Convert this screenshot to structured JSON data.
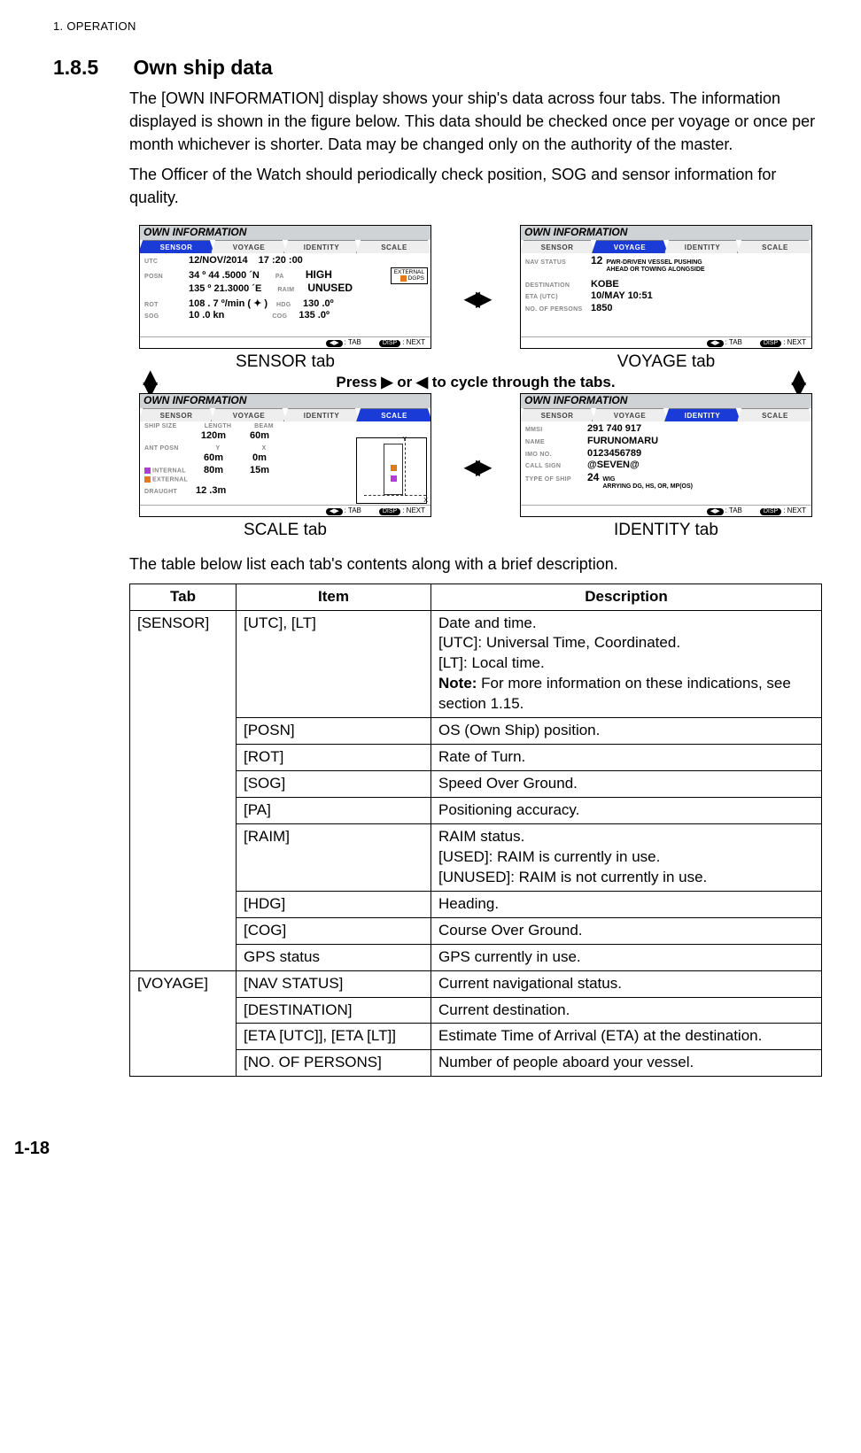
{
  "header": "1.  OPERATION",
  "section_num": "1.8.5",
  "section_title": "Own ship data",
  "para1": "The [OWN INFORMATION] display shows your ship's data across four tabs. The information displayed is shown in the figure below. This data should be checked once per voyage or once per month whichever is shorter. Data may be changed only on the authority of the master.",
  "para2": "The Officer of the Watch should periodically check position, SOG and sensor information for quality.",
  "panel_title": "OWN INFORMATION",
  "tabs": {
    "t1": "SENSOR",
    "t2": "VOYAGE",
    "t3": "IDENTITY",
    "t4": "SCALE"
  },
  "foot": {
    "tab": ": TAB",
    "next": ": NEXT",
    "icon1": "◀▶",
    "icon2": "DISP"
  },
  "cycle": {
    "lr": "◀▶",
    "ud": "◀▶"
  },
  "instruction": "Press ▶ or ◀ to cycle through the tabs.",
  "sensor": {
    "utc_l": "UTC",
    "utc_v": "12/NOV/2014",
    "utc_t": "17 :20 :00",
    "ext1": "EXTERNAL",
    "ext2": "DGPS",
    "posn_l": "POSN",
    "posn_v1": "34 º 44 .5000 ´N",
    "posn_v2": "135 º 21.3000 ´E",
    "pa_l": "PA",
    "pa_v": "HIGH",
    "raim_l": "RAIM",
    "raim_v": "UNUSED",
    "rot_l": "ROT",
    "rot_v": "108 . 7 º/min ( ✦ )",
    "sog_l": "SOG",
    "sog_v": "10 .0 kn",
    "hdg_l": "HDG",
    "hdg_v": "130 .0º",
    "cog_l": "COG",
    "cog_v": "135 .0º"
  },
  "voyage": {
    "nav_l": "NAV STATUS",
    "nav_n": "12",
    "nav_v1": "PWR-DRIVEN VESSEL PUSHING",
    "nav_v2": "AHEAD OR TOWING ALONGSIDE",
    "dest_l": "DESTINATION",
    "dest_v": "KOBE",
    "eta_l": "ETA (UTC)",
    "eta_v": "10/MAY 10:51",
    "nop_l": "NO. OF PERSONS",
    "nop_v": "1850"
  },
  "scale": {
    "ss_l": "SHIP SIZE",
    "len_l": "LENGTH",
    "len_v": "120m",
    "beam_l": "BEAM",
    "beam_v": "60m",
    "ant_l": "ANT  POSN",
    "y_l": "Y",
    "y_v": "60m",
    "x_l": "X",
    "x_v": "0m",
    "int_l": "INTERNAL",
    "int_v": "80m",
    "int_x": "15m",
    "ext_l": "EXTERNAL",
    "dr_l": "DRAUGHT",
    "dr_v": "12 .3m",
    "axis_y": "Y",
    "axis_x": "X"
  },
  "identity": {
    "mmsi_l": "MMSI",
    "mmsi_v": "291 740 917",
    "name_l": "NAME",
    "name_v": "FURUNOMARU",
    "imo_l": "IMO NO.",
    "imo_v": "0123456789",
    "cs_l": "CALL SIGN",
    "cs_v": "@SEVEN@",
    "tos_l": "TYPE OF SHIP",
    "tos_n": "24",
    "tos_v1": "WIG",
    "tos_v2": "ARRYING DG, HS, OR, MP(OS)"
  },
  "cap1": "SENSOR tab",
  "cap2": "VOYAGE tab",
  "cap3": "SCALE tab",
  "cap4": "IDENTITY tab",
  "table_intro": "The table below list each tab's contents along with a brief description.",
  "table": {
    "h1": "Tab",
    "h2": "Item",
    "h3": "Description",
    "r1c1": "[SENSOR]",
    "r1c2": "[UTC], [LT]",
    "r1c3a": "Date and time.",
    "r1c3b": "[UTC]: Universal Time, Coordinated.",
    "r1c3c": "[LT]: Local time.",
    "r1c3d": "Note:",
    "r1c3e": " For more information on these indications, see section 1.15.",
    "r2c2": "[POSN]",
    "r2c3": "OS (Own Ship) position.",
    "r3c2": "[ROT]",
    "r3c3": "Rate of Turn.",
    "r4c2": "[SOG]",
    "r4c3": "Speed Over Ground.",
    "r5c2": "[PA]",
    "r5c3": "Positioning accuracy.",
    "r6c2": "[RAIM]",
    "r6c3a": "RAIM status.",
    "r6c3b": "[USED]: RAIM is currently in use.",
    "r6c3c": "[UNUSED]: RAIM is not currently in use.",
    "r7c2": "[HDG]",
    "r7c3": "Heading.",
    "r8c2": "[COG]",
    "r8c3": "Course Over Ground.",
    "r9c2": "GPS status",
    "r9c3": "GPS currently in use.",
    "r10c1": "[VOYAGE]",
    "r10c2": "[NAV STATUS]",
    "r10c3": "Current navigational status.",
    "r11c2": "[DESTINATION]",
    "r11c3": "Current destination.",
    "r12c2": "[ETA [UTC]], [ETA [LT]]",
    "r12c3": "Estimate Time of Arrival (ETA) at the destination.",
    "r13c2": "[NO. OF PERSONS]",
    "r13c3": "Number of people aboard your vessel."
  },
  "page_num": "1-18"
}
